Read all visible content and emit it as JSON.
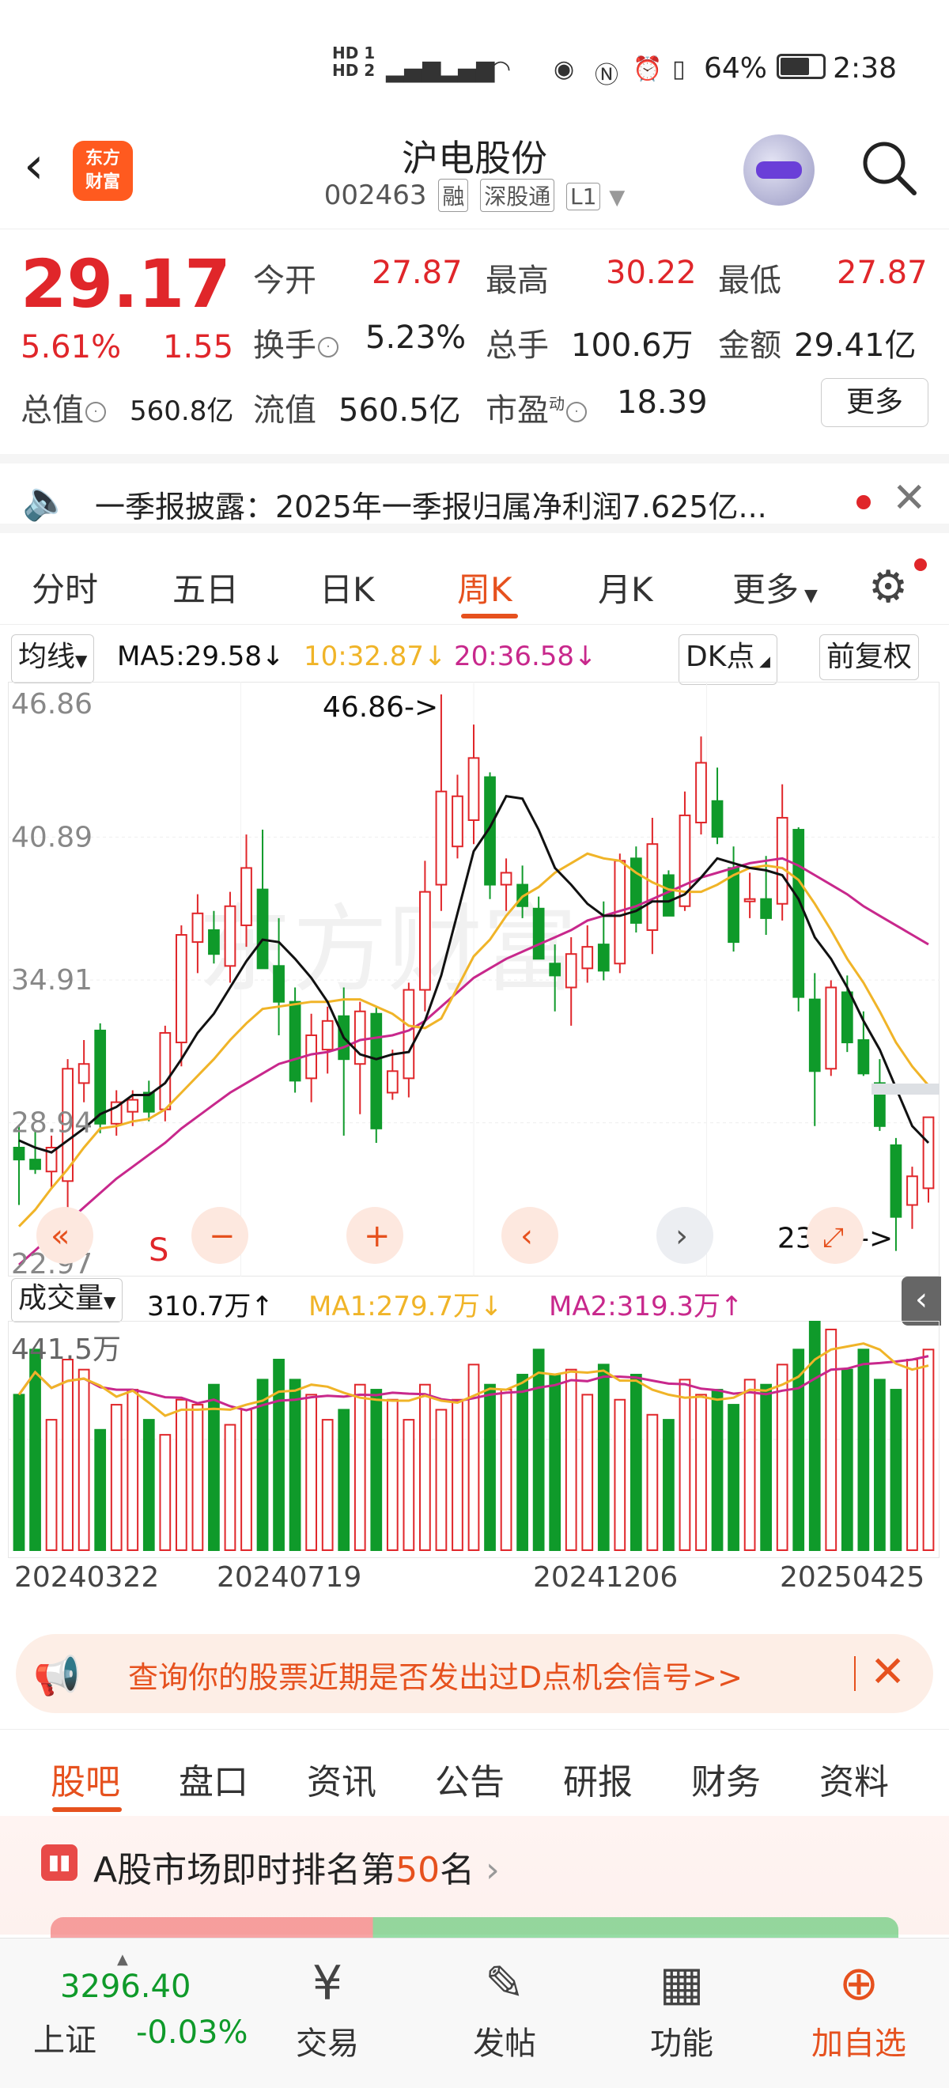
{
  "status_bar": {
    "network": "HD1 HD2 5G 4G",
    "battery": "64%",
    "time": "2:38"
  },
  "header": {
    "logo_text": "东方财富",
    "title": "沪电股份",
    "code": "002463",
    "tags": [
      "融",
      "深股通",
      "L1"
    ]
  },
  "quote": {
    "price": "29.17",
    "change_pct": "5.61%",
    "change": "1.55",
    "open_label": "今开",
    "open": "27.87",
    "high_label": "最高",
    "high": "30.22",
    "low_label": "最低",
    "low": "27.87",
    "turnover_label": "换手",
    "turnover": "5.23%",
    "volume_label": "总手",
    "volume": "100.6万",
    "amount_label": "金额",
    "amount": "29.41亿",
    "mktcap_label": "总值",
    "mktcap": "560.8亿",
    "float_label": "流值",
    "float": "560.5亿",
    "pe_label": "市盈",
    "pe_sup": "动",
    "pe": "18.39",
    "more": "更多"
  },
  "notice": {
    "text": "一季报披露：2025年一季报归属净利润7.625亿..."
  },
  "k_tabs": [
    "分时",
    "五日",
    "日K",
    "周K",
    "月K",
    "更多"
  ],
  "k_active": "周K",
  "ma_bar": {
    "selector": "均线",
    "ma5": "MA5:29.58↓",
    "ma10": "10:32.87↓",
    "ma20": "20:36.58↓",
    "dk": "DK点",
    "adjust": "前复权"
  },
  "chart_labels": {
    "y_ticks": [
      "46.86",
      "40.89",
      "34.91",
      "28.94",
      "22.97"
    ],
    "max_marker": "46.86->",
    "min_marker": "23.58->",
    "signal": "S"
  },
  "volume_bar": {
    "selector": "成交量",
    "value": "310.7万↑",
    "ma1": "MA1:279.7万↓",
    "ma2": "MA2:319.3万↑",
    "top_tick": "441.5万"
  },
  "dates": [
    "20240322",
    "20240719",
    "20241206",
    "20250425"
  ],
  "colors": {
    "up": "#e0262a",
    "down": "#0f9a2a",
    "ma5": "#111111",
    "ma10": "#f0b428",
    "ma20": "#c8288c",
    "accent": "#e6511e"
  },
  "chart_data": {
    "type": "candlestick",
    "ylim": [
      22.97,
      46.86
    ],
    "ohlc": [
      [
        27.9,
        28.8,
        25.5,
        27.4
      ],
      [
        27.4,
        28.6,
        26.8,
        27.0
      ],
      [
        26.9,
        28.4,
        26.2,
        27.9
      ],
      [
        26.5,
        31.6,
        24.6,
        31.2
      ],
      [
        30.6,
        32.4,
        29.8,
        31.4
      ],
      [
        32.8,
        33.1,
        28.5,
        28.9
      ],
      [
        28.9,
        30.3,
        28.4,
        29.8
      ],
      [
        29.4,
        30.3,
        28.8,
        29.9
      ],
      [
        30.2,
        30.7,
        29.0,
        29.4
      ],
      [
        29.5,
        33.0,
        29.0,
        32.7
      ],
      [
        32.3,
        37.2,
        31.3,
        36.8
      ],
      [
        36.5,
        38.5,
        35.2,
        37.7
      ],
      [
        37.0,
        37.8,
        35.6,
        36.0
      ],
      [
        35.5,
        38.6,
        34.8,
        38.0
      ],
      [
        37.2,
        41.0,
        36.3,
        39.6
      ],
      [
        38.7,
        41.2,
        35.5,
        35.4
      ],
      [
        35.5,
        37.5,
        32.6,
        34.0
      ],
      [
        34.0,
        34.6,
        30.2,
        30.7
      ],
      [
        30.8,
        33.5,
        29.8,
        32.6
      ],
      [
        32.0,
        33.8,
        31.0,
        33.2
      ],
      [
        33.4,
        34.6,
        28.4,
        31.6
      ],
      [
        31.4,
        34.0,
        29.3,
        33.6
      ],
      [
        33.5,
        33.8,
        28.1,
        28.7
      ],
      [
        30.2,
        32.0,
        29.9,
        31.1
      ],
      [
        30.8,
        34.8,
        30.0,
        34.5
      ],
      [
        34.5,
        39.9,
        33.6,
        38.6
      ],
      [
        38.9,
        46.86,
        37.8,
        42.8
      ],
      [
        40.5,
        43.5,
        40.0,
        42.6
      ],
      [
        41.6,
        45.6,
        40.6,
        44.2
      ],
      [
        43.4,
        43.6,
        38.3,
        38.9
      ],
      [
        38.9,
        40.0,
        37.8,
        39.4
      ],
      [
        38.9,
        39.7,
        37.5,
        38.0
      ],
      [
        37.9,
        38.4,
        36.0,
        35.8
      ],
      [
        35.6,
        36.4,
        33.6,
        35.1
      ],
      [
        34.6,
        36.7,
        33.0,
        36.0
      ],
      [
        35.4,
        37.2,
        34.8,
        36.3
      ],
      [
        36.4,
        38.2,
        34.9,
        35.3
      ],
      [
        35.6,
        40.2,
        35.2,
        39.9
      ],
      [
        40.0,
        40.5,
        36.9,
        37.3
      ],
      [
        37.0,
        41.7,
        36.0,
        40.6
      ],
      [
        39.3,
        39.5,
        37.6,
        37.6
      ],
      [
        38.0,
        42.8,
        37.8,
        41.8
      ],
      [
        41.5,
        45.1,
        41.0,
        44.0
      ],
      [
        42.4,
        43.8,
        40.6,
        40.9
      ],
      [
        39.6,
        40.5,
        36.1,
        36.5
      ],
      [
        38.2,
        39.4,
        37.5,
        38.3
      ],
      [
        38.3,
        40.1,
        36.8,
        37.5
      ],
      [
        38.1,
        43.1,
        37.4,
        41.7
      ],
      [
        41.2,
        41.3,
        33.6,
        34.2
      ],
      [
        34.1,
        35.2,
        28.8,
        31.1
      ],
      [
        31.2,
        34.9,
        30.9,
        34.6
      ],
      [
        34.4,
        35.1,
        31.9,
        32.3
      ],
      [
        32.4,
        33.6,
        30.9,
        31.0
      ],
      [
        30.6,
        31.6,
        28.6,
        28.8
      ],
      [
        28.0,
        28.3,
        23.58,
        25.0
      ],
      [
        25.5,
        27.1,
        24.5,
        26.7
      ],
      [
        26.2,
        28.2,
        25.6,
        29.17
      ]
    ],
    "volume": [
      310,
      400,
      260,
      380,
      360,
      240,
      290,
      320,
      260,
      230,
      300,
      290,
      330,
      250,
      280,
      340,
      380,
      340,
      310,
      260,
      280,
      330,
      320,
      300,
      260,
      330,
      280,
      300,
      370,
      330,
      320,
      350,
      400,
      350,
      360,
      310,
      370,
      300,
      350,
      270,
      260,
      340,
      310,
      320,
      290,
      340,
      330,
      370,
      400,
      460,
      440,
      360,
      400,
      340,
      320,
      380,
      400
    ],
    "ma5": [
      28.2,
      27.9,
      27.7,
      28.2,
      28.7,
      29.3,
      29.6,
      30.1,
      30.1,
      30.6,
      31.6,
      32.7,
      33.5,
      34.6,
      35.7,
      36.6,
      36.5,
      35.8,
      35.0,
      34.0,
      32.5,
      31.8,
      31.6,
      31.8,
      31.9,
      33.2,
      35.1,
      37.7,
      40.3,
      41.3,
      42.6,
      42.5,
      41.2,
      39.6,
      38.9,
      38.1,
      37.6,
      37.6,
      37.8,
      38.2,
      38.2,
      38.5,
      39.2,
      40.0,
      39.8,
      39.6,
      39.5,
      39.3,
      38.3,
      36.7,
      35.8,
      34.6,
      33.2,
      32.0,
      30.4,
      28.8,
      28.1
    ],
    "ma10": [
      24.6,
      25.3,
      26.2,
      27.0,
      27.9,
      28.7,
      28.8,
      29.0,
      29.1,
      29.5,
      30.2,
      30.9,
      31.6,
      32.4,
      33.1,
      33.7,
      33.8,
      33.9,
      34.0,
      34.0,
      34.1,
      34.1,
      33.8,
      33.5,
      33.0,
      32.9,
      33.3,
      34.6,
      35.9,
      36.6,
      37.6,
      38.4,
      38.8,
      39.4,
      39.8,
      40.2,
      40.0,
      39.9,
      39.4,
      39.0,
      38.7,
      38.6,
      38.6,
      38.9,
      39.3,
      39.6,
      39.7,
      39.6,
      39.1,
      38.1,
      37.0,
      35.8,
      34.8,
      33.6,
      32.3,
      31.3,
      30.5
    ],
    "ma20": [
      23.0,
      23.6,
      24.2,
      24.8,
      25.4,
      26.0,
      26.6,
      27.1,
      27.6,
      28.1,
      28.7,
      29.2,
      29.7,
      30.2,
      30.6,
      31.0,
      31.4,
      31.6,
      31.8,
      31.9,
      32.1,
      32.4,
      32.5,
      32.6,
      32.8,
      33.2,
      33.8,
      34.4,
      35.0,
      35.4,
      35.8,
      36.1,
      36.4,
      36.7,
      37.0,
      37.4,
      37.6,
      37.8,
      38.0,
      38.3,
      38.6,
      38.9,
      39.2,
      39.4,
      39.6,
      39.8,
      39.9,
      40.0,
      39.7,
      39.3,
      38.9,
      38.5,
      38.0,
      37.6,
      37.2,
      36.8,
      36.4
    ]
  },
  "bottom_tabs": [
    "股吧",
    "盘口",
    "资讯",
    "公告",
    "研报",
    "财务",
    "资料"
  ],
  "bottom_active": "股吧",
  "banner": {
    "text": "查询你的股票近期是否发出过D点机会信号>>"
  },
  "rank": {
    "prefix": "A股市场即时排名第",
    "num": "50",
    "suffix": "名"
  },
  "nav": {
    "index_value": "3296.40",
    "index_name": "上证",
    "index_change": "-0.03%",
    "items": [
      "交易",
      "发帖",
      "功能",
      "加自选"
    ]
  }
}
